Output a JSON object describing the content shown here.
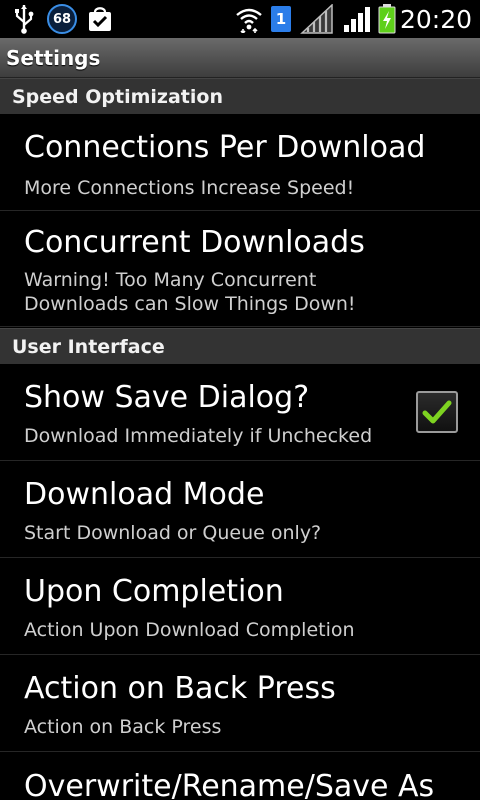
{
  "status_bar": {
    "clock": "20:20",
    "notification_badge": "68",
    "sim_badge": "1",
    "icons": [
      "usb-icon",
      "notification-count-icon",
      "download-complete-icon",
      "wifi-icon",
      "sim-card-icon",
      "no-signal-icon",
      "signal-strength-icon",
      "battery-charging-icon"
    ]
  },
  "header": {
    "title": "Settings"
  },
  "sections": [
    {
      "title": "Speed Optimization",
      "items": [
        {
          "title": "Connections Per Download",
          "summary": "More Connections Increase Speed!"
        },
        {
          "title": "Concurrent Downloads",
          "summary": "Warning! Too Many Concurrent Downloads can Slow Things Down!"
        }
      ]
    },
    {
      "title": "User Interface",
      "items": [
        {
          "title": "Show Save Dialog?",
          "summary": "Download Immediately if Unchecked",
          "checked": true
        },
        {
          "title": "Download Mode",
          "summary": "Start Download or Queue only?"
        },
        {
          "title": "Upon Completion",
          "summary": "Action Upon Download Completion"
        },
        {
          "title": "Action on Back Press",
          "summary": "Action on Back Press"
        },
        {
          "title": "Overwrite/Rename/Save As",
          "summary": ""
        }
      ]
    }
  ],
  "colors": {
    "checkmark": "#7ed321",
    "title_bar": "#555555",
    "section_header": "#333333",
    "battery_fill": "#5ed01a"
  }
}
